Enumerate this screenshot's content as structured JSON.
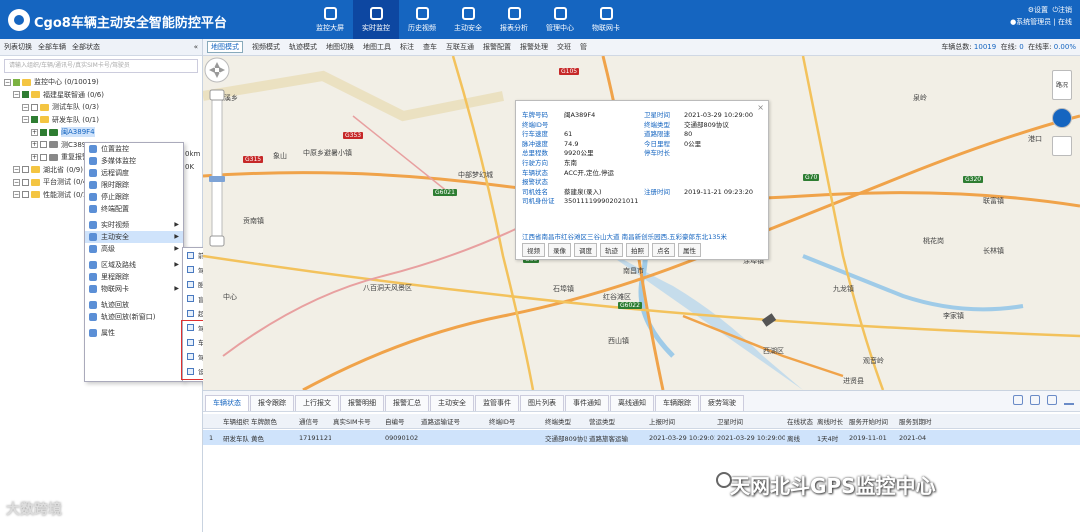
{
  "header": {
    "title": "Cgo8车辆主动安全智能防控平台",
    "nav": [
      "监控大屏",
      "实时监控",
      "历史视频",
      "主动安全",
      "报表分析",
      "管理中心",
      "物联网卡"
    ],
    "active_nav": "实时监控",
    "settings": "设置",
    "logout": "注销",
    "user": "系统管理员",
    "user_suffix": "| 在线"
  },
  "left": {
    "toolbar": [
      "列表切换",
      "全部车辆",
      "全部状态"
    ],
    "search_placeholder": "请输入组织/车辆/通讯号/真实SIM卡号/驾驶员",
    "tree": [
      {
        "label": "监控中心 (0/10019)",
        "level": 0
      },
      {
        "label": "福建星联智通 (0/6)",
        "level": 1
      },
      {
        "label": "测试车队 (0/3)",
        "level": 2
      },
      {
        "label": "研发车队 (0/1)",
        "level": 2
      },
      {
        "label": "闽A389F4",
        "level": 3
      },
      {
        "label": "测C389G",
        "level": 3
      },
      {
        "label": "重复报警",
        "level": 3
      },
      {
        "label": "湖北省 (0/9)",
        "level": 1
      },
      {
        "label": "平台测试 (0/4)",
        "level": 1
      },
      {
        "label": "性能测试 (0/1)",
        "level": 1
      }
    ],
    "tree_fragments": [
      "0km",
      "0K"
    ],
    "context_menu": [
      {
        "label": "位置监控"
      },
      {
        "label": "多媒体监控"
      },
      {
        "label": "远程调度"
      },
      {
        "label": "限时跟踪"
      },
      {
        "label": "停止跟踪"
      },
      {
        "label": "终端配置"
      },
      {
        "label": "实时视频",
        "arrow": true
      },
      {
        "label": "主动安全",
        "arrow": true,
        "selected": true
      },
      {
        "label": "高级",
        "arrow": true
      },
      {
        "label": "区域及路线",
        "arrow": true
      },
      {
        "label": "里程跟踪"
      },
      {
        "label": "物联网卡",
        "arrow": true
      },
      {
        "label": "轨迹回放"
      },
      {
        "label": "轨迹回放(新窗口)"
      },
      {
        "label": "属性"
      }
    ],
    "submenu": [
      "前向预警设备参数配置",
      "驾驶分析设备参数设置",
      "胎压监测设备参数设置",
      "盲区监测设备参数设置",
      "超员检测设备参数设置",
      "驾驶员身份识别参数（黑标）",
      "车辆运行监测参数（黑标）",
      "驾驶员驾驶行为参数（黑标）",
      "设备失效监测参数（黑标）"
    ]
  },
  "map_toolbar": {
    "buttons": [
      "地图模式",
      "视频模式",
      "轨迹模式",
      "地图切换",
      "地图工具",
      "标注",
      "查车",
      "互联互通",
      "报警配置",
      "报警处理",
      "交班",
      "管"
    ],
    "total_label": "车辆总数:",
    "total": "10019",
    "online_label": "在线:",
    "online": "0",
    "rate_label": "在线率:",
    "rate": "0.00%"
  },
  "map": {
    "place_labels": [
      "贵溪乡",
      "中原乡避暑小镇",
      "中部梦幻城",
      "八百洞天风景区",
      "象山",
      "贡南镇",
      "中心",
      "石埠镇",
      "东乡镇",
      "红谷滩区",
      "南昌市",
      "九龙镇",
      "桃花岗",
      "泉岭",
      "港口",
      "西山镇",
      "观音岭",
      "长林镇",
      "联富镇",
      "李家镇",
      "西湖区",
      "进贤县",
      "涂埠镇"
    ],
    "road_labels": [
      "G105",
      "G353",
      "G315",
      "G60",
      "G6021",
      "G70",
      "G320",
      "G6022"
    ],
    "road_toggle": "路况",
    "popup": {
      "fields": [
        {
          "k": "车牌号码",
          "v": "闽A389F4"
        },
        {
          "k": "终端ID号",
          "v": ""
        },
        {
          "k": "行车速度",
          "v": "61"
        },
        {
          "k": "脉冲速度",
          "v": "74.9"
        },
        {
          "k": "总里程数",
          "v": "9920公里"
        },
        {
          "k": "行驶方向",
          "v": "东南"
        },
        {
          "k": "车辆状态",
          "v": "ACC开,定位,停运"
        },
        {
          "k": "报警状态",
          "v": ""
        },
        {
          "k": "司机姓名",
          "v": "蔡建泉(录入)"
        },
        {
          "k": "司机身份证",
          "v": "350111199902021011"
        }
      ],
      "fields_right": [
        {
          "k": "卫星时间",
          "v": "2021-03-29 10:29:00"
        },
        {
          "k": "终端类型",
          "v": "交通部809协议"
        },
        {
          "k": "道路限速",
          "v": "80"
        },
        {
          "k": "今日里程",
          "v": "0公里"
        },
        {
          "k": "停车时长",
          "v": ""
        },
        {
          "k": "注册时间",
          "v": "2019-11-21 09:23:20"
        }
      ],
      "address": "江西省南昌市红谷滩区三谷山大道 南昌新创乐园西,五彩豪郎东北135米",
      "buttons": [
        "视频",
        "录像",
        "调度",
        "轨迹",
        "拍照",
        "点名",
        "属性"
      ],
      "close": "×"
    }
  },
  "bottom": {
    "tabs": [
      "车辆状态",
      "报令跟踪",
      "上行报文",
      "报警明细",
      "报警汇总",
      "主动安全",
      "监管事件",
      "图片列表",
      "事件通知",
      "离线通知",
      "车辆跟踪",
      "疲劳驾驶"
    ],
    "columns": [
      "车辆组织",
      "车牌颜色",
      "通信号",
      "真实SIM卡号",
      "自编号",
      "道路运输证号",
      "终端ID号",
      "终端类型",
      "营运类型",
      "上报时间",
      "卫星时间",
      "在线状态",
      "离线时长",
      "服务开始时间",
      "服务到期时"
    ],
    "row": [
      "研发车队",
      "黄色",
      "17191121001",
      "",
      "09090102",
      "",
      "",
      "交通部809协议",
      "道路旅客运输",
      "2021-03-29 10:29:01",
      "2021-03-29 10:29:00",
      "离线",
      "1天4时",
      "2019-11-01",
      "2021-04"
    ],
    "row_index": "1"
  },
  "watermarks": {
    "left": "大数跨境",
    "right": "天网北斗GPS监控中心"
  },
  "colors": {
    "brand": "#1565c0",
    "selection": "#cfe3fb",
    "highlight_box": "#e03030"
  }
}
